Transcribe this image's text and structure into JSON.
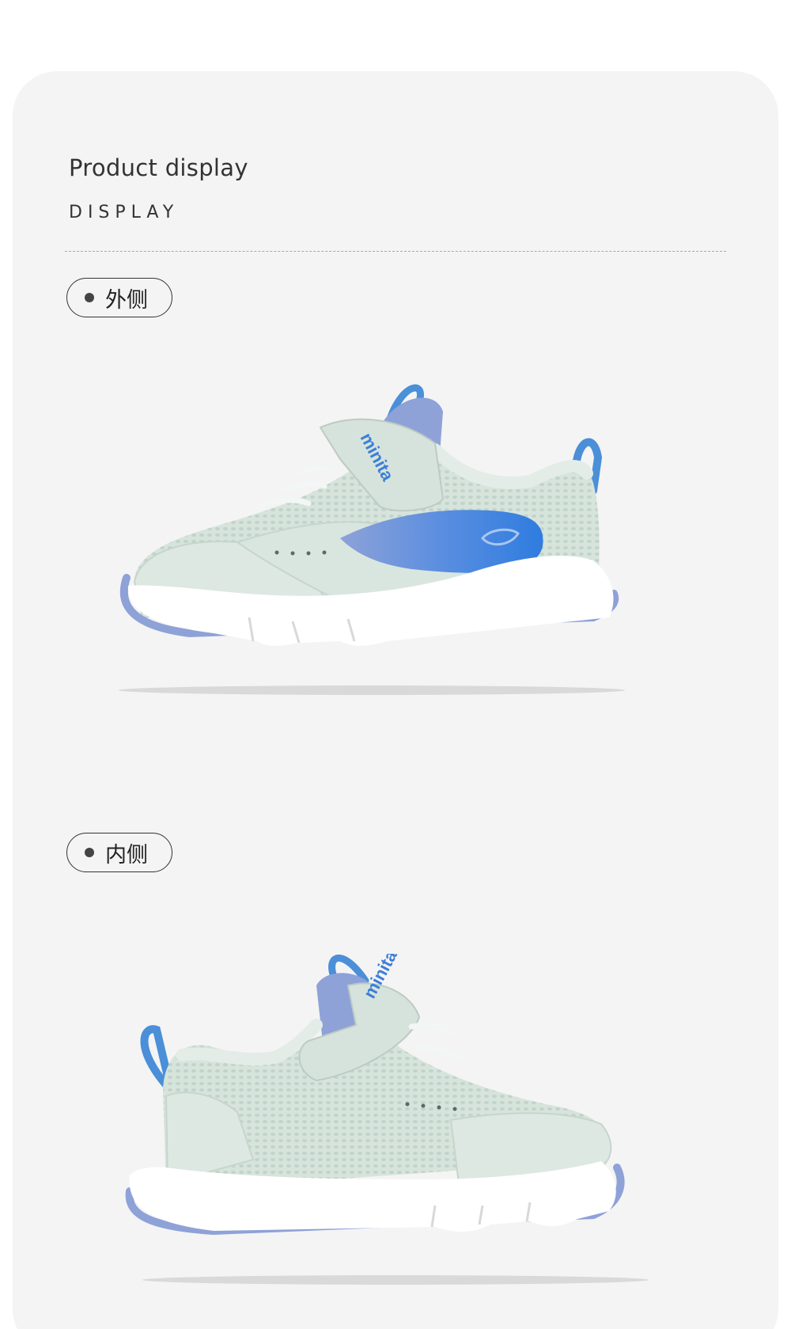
{
  "header": {
    "title": "Product display",
    "subtitle": "DISPLAY"
  },
  "views": [
    {
      "label": "外侧",
      "brand_text": "minita"
    },
    {
      "label": "内侧",
      "brand_text": "minita"
    }
  ],
  "colors": {
    "panel_bg": "#f4f4f4",
    "shoe_upper": "#d9e6df",
    "shoe_sole": "#ffffff",
    "accent_blue": "#3d7fd6",
    "lilac": "#8ea2d8"
  }
}
